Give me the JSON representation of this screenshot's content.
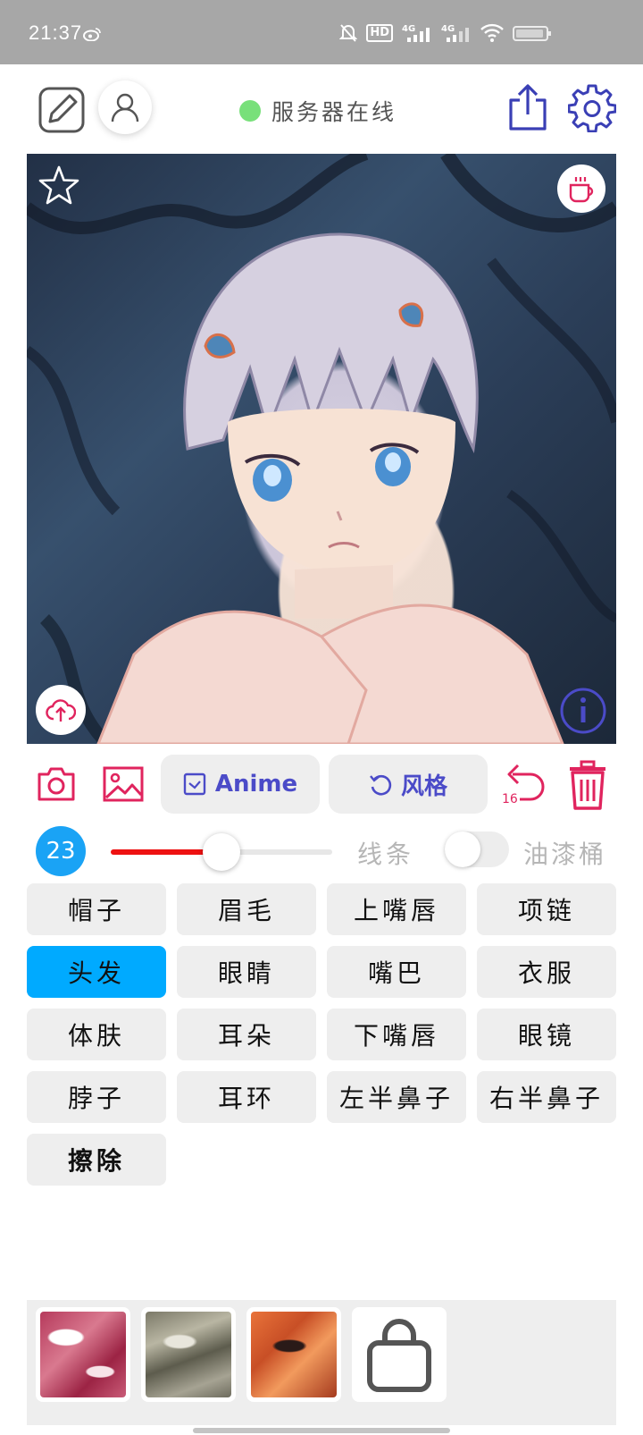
{
  "status_bar": {
    "time": "21:37",
    "icons": [
      "weibo-icon",
      "mute-icon",
      "hd-icon",
      "signal-4g-icon",
      "signal-4g-icon",
      "wifi-icon",
      "battery-icon"
    ],
    "hd_label": "HD",
    "network_label": "4G"
  },
  "header": {
    "server_status": "服务器在线",
    "server_status_color": "#78e07a",
    "icons": [
      "edit-icon",
      "user-icon",
      "share-icon",
      "settings-icon"
    ]
  },
  "canvas": {
    "icons": [
      "star-icon",
      "coffee-icon",
      "cloud-upload-icon",
      "info-icon"
    ]
  },
  "toolbar": {
    "anime_label": "Anime",
    "style_label": "风格",
    "undo_count": "16",
    "accent_color": "#e0245e",
    "pill_text_color": "#4b4bc8"
  },
  "brush": {
    "size": "23",
    "slider_fraction": 0.5,
    "lines_label": "线条",
    "bucket_label": "油漆桶",
    "bucket_enabled": false
  },
  "parts": [
    {
      "label": "帽子",
      "active": false
    },
    {
      "label": "眉毛",
      "active": false
    },
    {
      "label": "上嘴唇",
      "active": false
    },
    {
      "label": "项链",
      "active": false
    },
    {
      "label": "头发",
      "active": true
    },
    {
      "label": "眼睛",
      "active": false
    },
    {
      "label": "嘴巴",
      "active": false
    },
    {
      "label": "衣服",
      "active": false
    },
    {
      "label": "体肤",
      "active": false
    },
    {
      "label": "耳朵",
      "active": false
    },
    {
      "label": "下嘴唇",
      "active": false
    },
    {
      "label": "眼镜",
      "active": false
    },
    {
      "label": "脖子",
      "active": false
    },
    {
      "label": "耳环",
      "active": false
    },
    {
      "label": "左半鼻子",
      "active": false
    },
    {
      "label": "右半鼻子",
      "active": false
    },
    {
      "label": "擦除",
      "active": false
    }
  ],
  "styles": {
    "thumbnails": [
      "style-red",
      "style-gray",
      "style-orange"
    ],
    "shop_icon": "shopping-bag-icon"
  }
}
